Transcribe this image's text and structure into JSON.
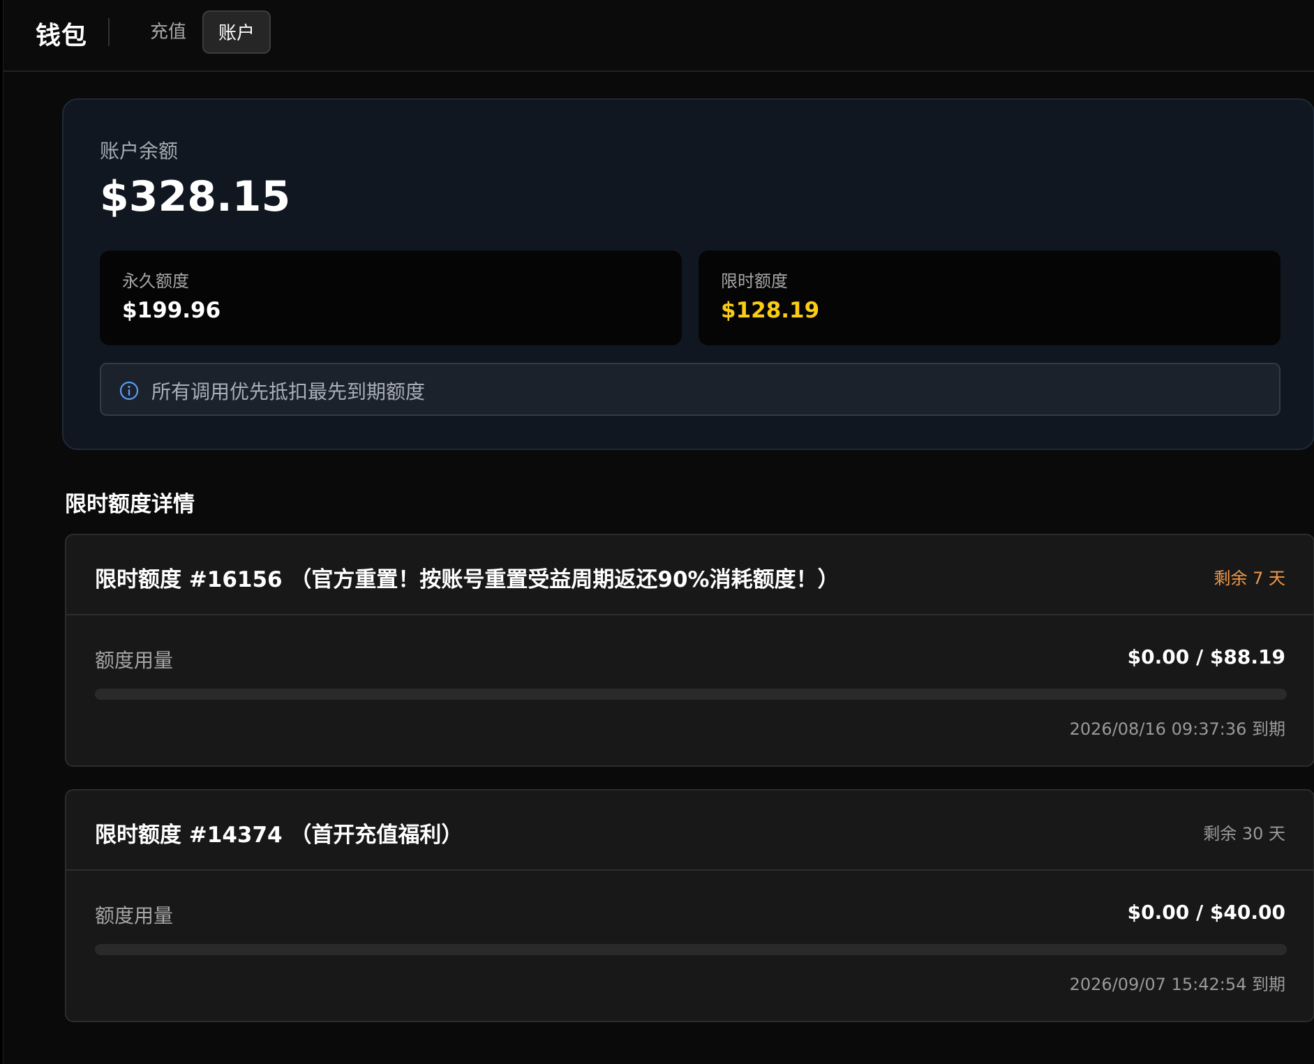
{
  "header": {
    "title": "钱包",
    "tabs": [
      {
        "label": "充值",
        "active": false
      },
      {
        "label": "账户",
        "active": true
      }
    ]
  },
  "balance": {
    "label": "账户余额",
    "value": "$328.15",
    "permanent": {
      "label": "永久额度",
      "value": "$199.96"
    },
    "limited": {
      "label": "限时额度",
      "value": "$128.19"
    },
    "notice": {
      "icon": "info-icon",
      "text": "所有调用优先抵扣最先到期额度"
    }
  },
  "details": {
    "title": "限时额度详情",
    "grants": [
      {
        "title": "限时额度 #16156 （官方重置！按账号重置受益周期返还90%消耗额度！）",
        "remaining": "剩余 7 天",
        "remaining_color": "#f2994a",
        "usage_label": "额度用量",
        "usage_value": "$0.00 / $88.19",
        "usage_fraction": 0,
        "expiry": "2026/08/16 09:37:36 到期"
      },
      {
        "title": "限时额度 #14374 （首开充值福利）",
        "remaining": "剩余 30 天",
        "remaining_color": "#9a9a9a",
        "usage_label": "额度用量",
        "usage_value": "$0.00 / $40.00",
        "usage_fraction": 0,
        "expiry": "2026/09/07 15:42:54 到期"
      }
    ]
  },
  "colors": {
    "accent_gold": "#facc15",
    "info_blue": "#5b9cf5"
  }
}
